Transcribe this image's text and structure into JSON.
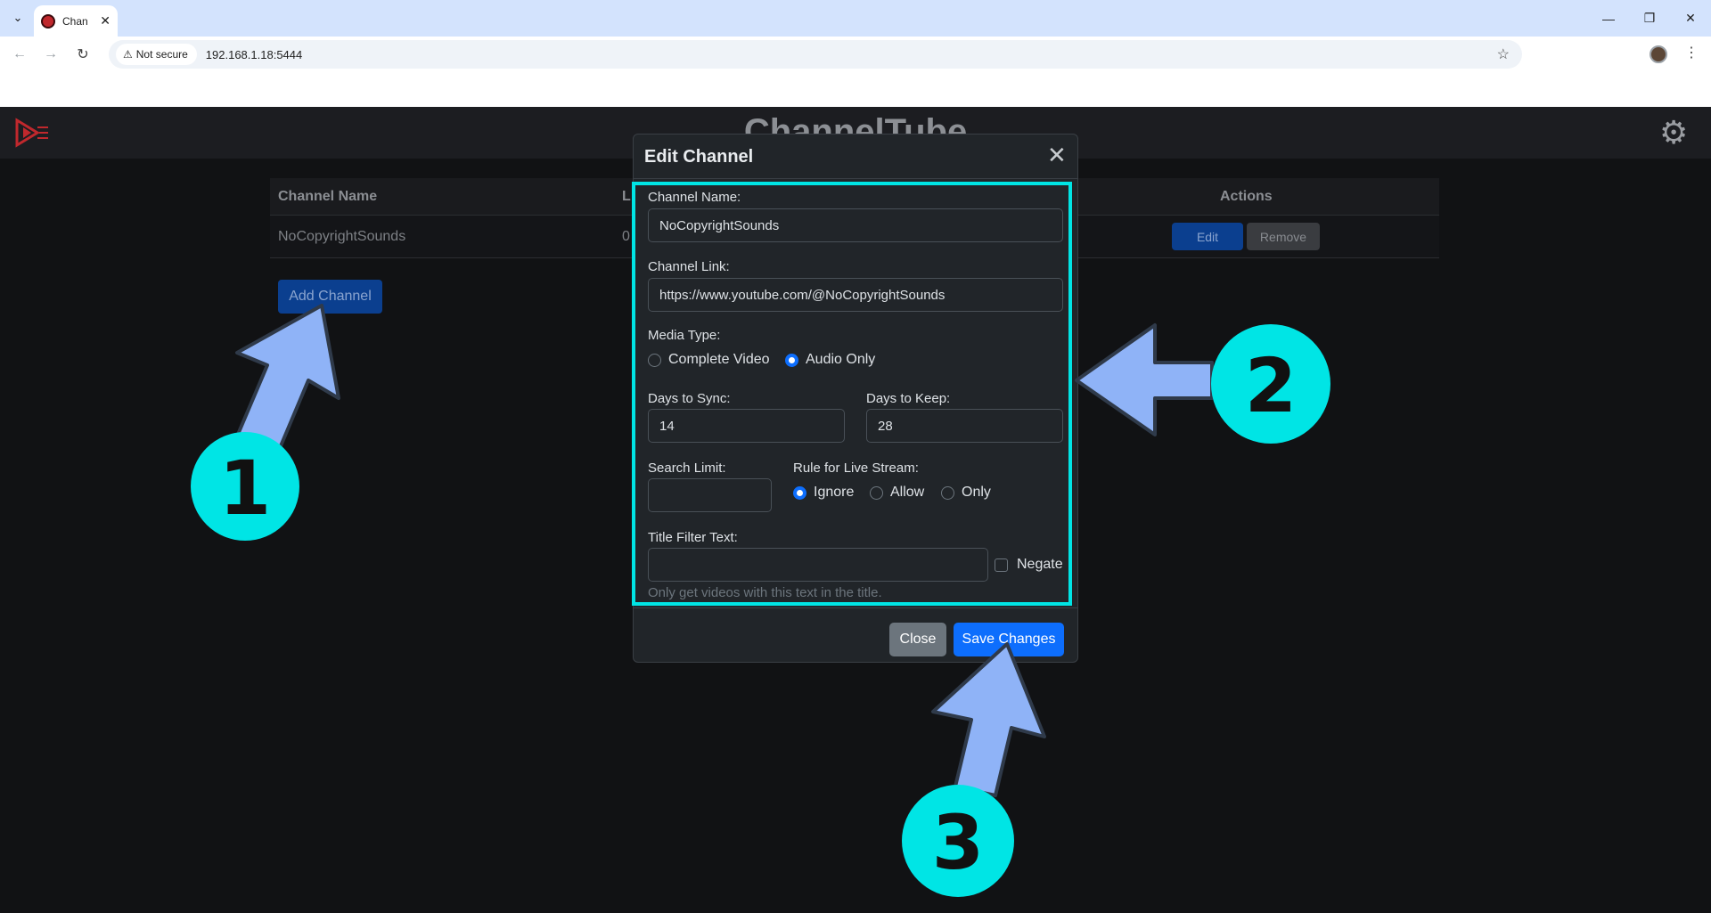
{
  "browser": {
    "tab_title": "Chan",
    "tab_close": "✕",
    "security_label": "Not secure",
    "url": "192.168.1.18:5444"
  },
  "app": {
    "title": "ChannelTube"
  },
  "table": {
    "headers": {
      "name": "Channel Name",
      "l": "L",
      "actions": "Actions"
    },
    "rows": [
      {
        "name": "NoCopyrightSounds",
        "l": "0",
        "edit": "Edit",
        "remove": "Remove"
      }
    ],
    "add_button": "Add Channel"
  },
  "modal": {
    "title": "Edit Channel",
    "channel_name_label": "Channel Name:",
    "channel_name_value": "NoCopyrightSounds",
    "channel_link_label": "Channel Link:",
    "channel_link_value": "https://www.youtube.com/@NoCopyrightSounds",
    "media_type_label": "Media Type:",
    "media_type_options": [
      "Complete Video",
      "Audio Only"
    ],
    "media_type_selected": "Audio Only",
    "days_sync_label": "Days to Sync:",
    "days_sync_value": "14",
    "days_keep_label": "Days to Keep:",
    "days_keep_value": "28",
    "search_limit_label": "Search Limit:",
    "search_limit_value": "",
    "live_rule_label": "Rule for Live Stream:",
    "live_rule_options": [
      "Ignore",
      "Allow",
      "Only"
    ],
    "live_rule_selected": "Ignore",
    "title_filter_label": "Title Filter Text:",
    "title_filter_value": "",
    "negate_label": "Negate",
    "negate_checked": false,
    "title_filter_hint": "Only get videos with this text in the title.",
    "close_button": "Close",
    "save_button": "Save Changes"
  },
  "annotations": {
    "step_1": "1",
    "step_2": "2",
    "step_3": "3",
    "arrow_color": "#8fb3f7",
    "badge_color": "#00e5e5",
    "highlight_color": "#00e5e5"
  }
}
